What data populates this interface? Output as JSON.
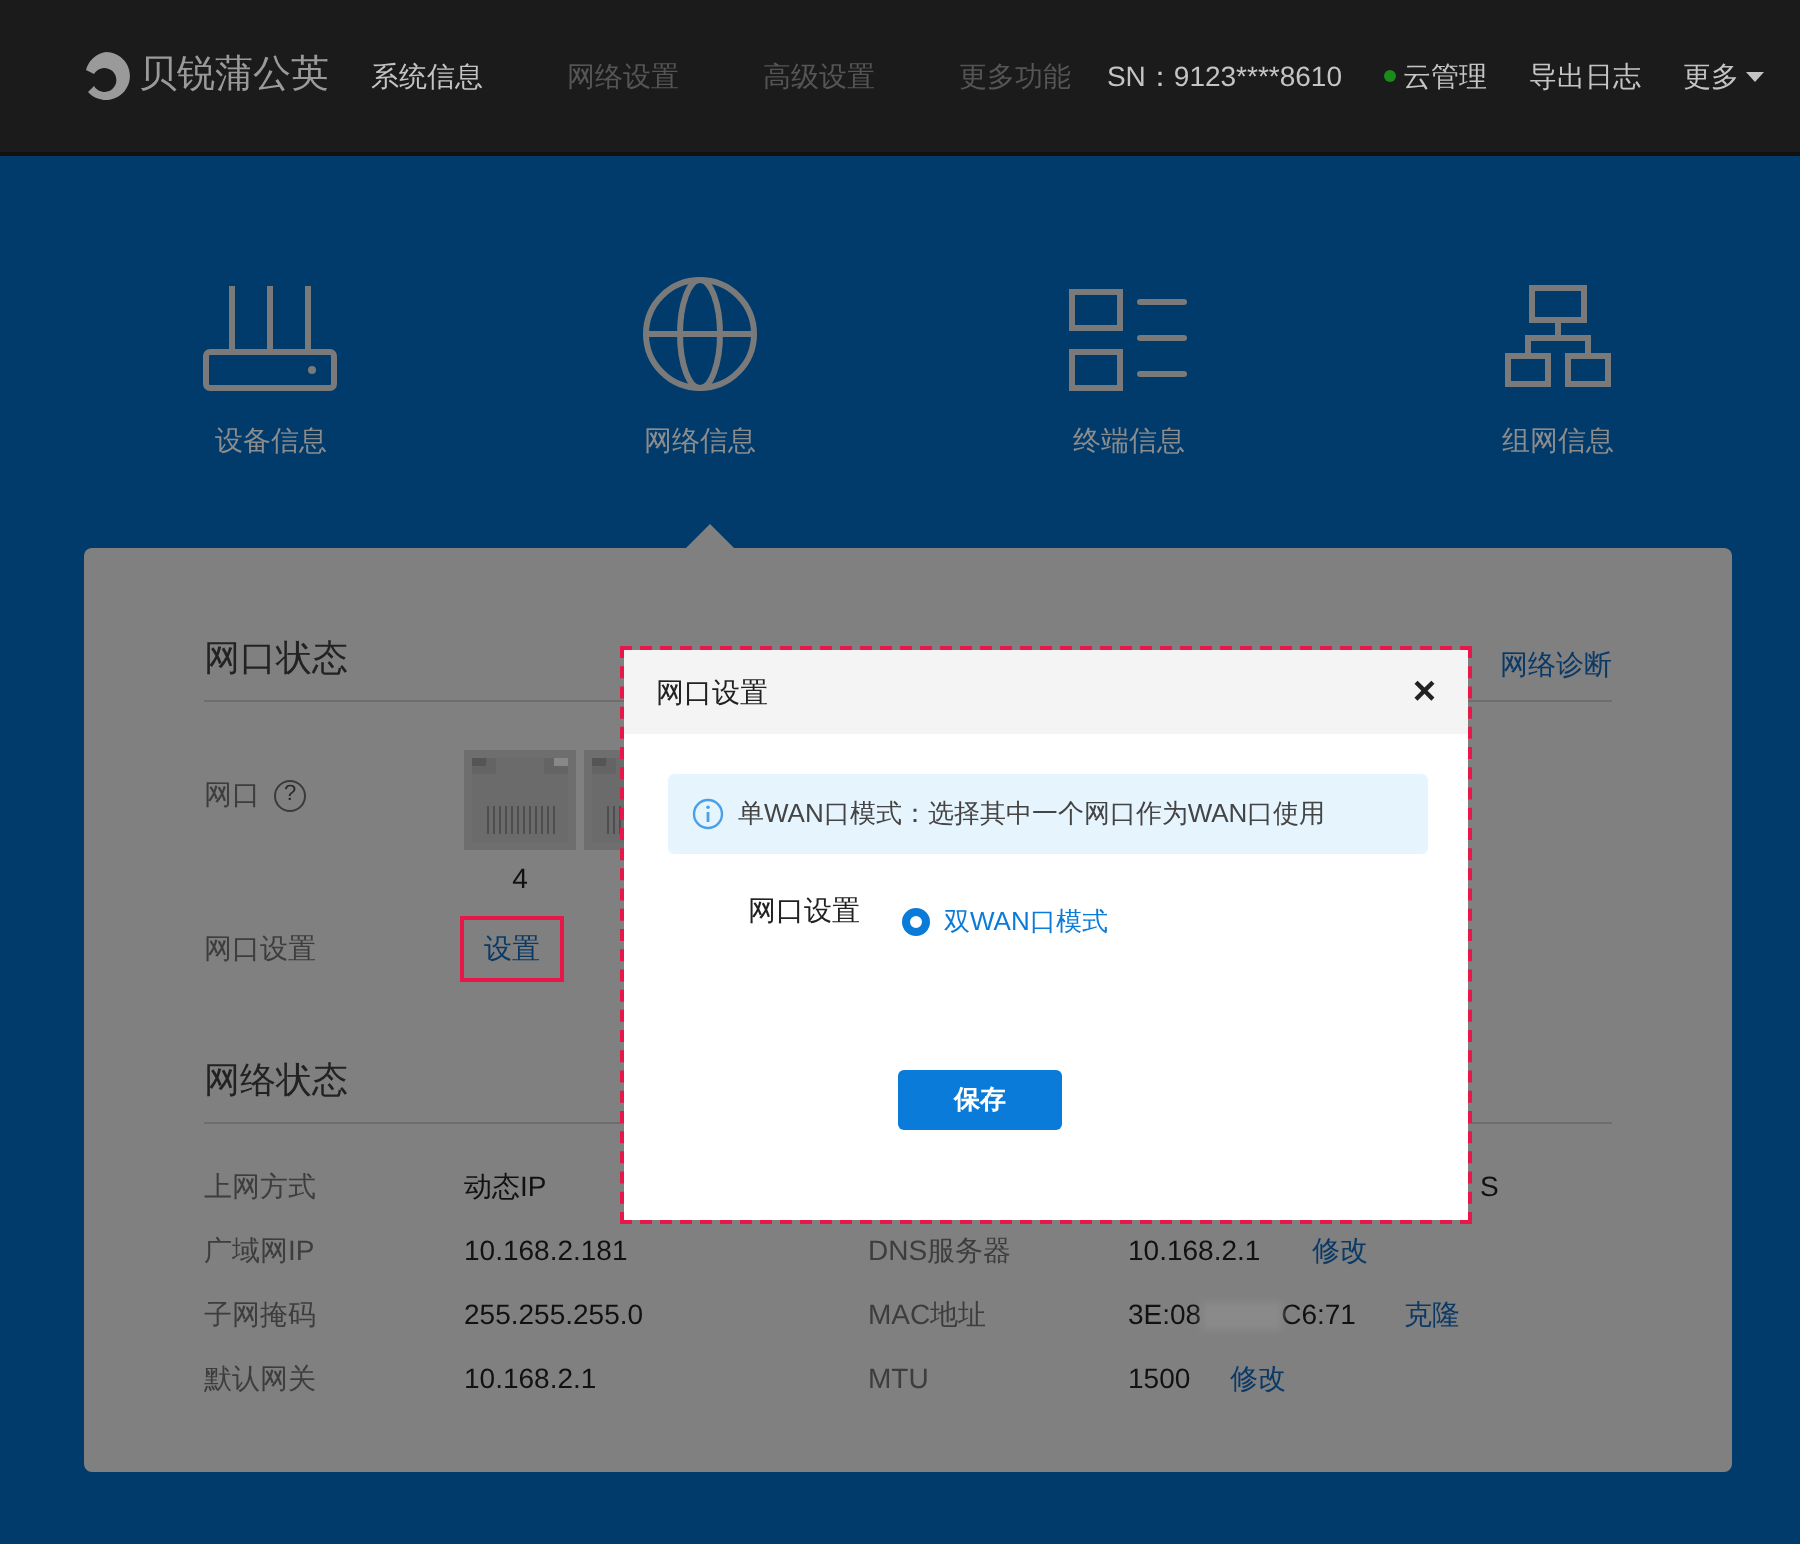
{
  "navbar": {
    "logo": "贝锐蒲公英",
    "items": [
      {
        "label": "系统信息",
        "selected": true
      },
      {
        "label": "网络设置",
        "selected": false
      },
      {
        "label": "高级设置",
        "selected": false
      },
      {
        "label": "更多功能",
        "selected": false
      }
    ],
    "sn": "SN：9123****8610",
    "cloud": {
      "label": "云管理",
      "online": true
    },
    "export": "导出日志",
    "more": "更多"
  },
  "categories": [
    {
      "label": "设备信息",
      "kind": "router",
      "selected": false
    },
    {
      "label": "网络信息",
      "kind": "globe",
      "selected": true
    },
    {
      "label": "终端信息",
      "kind": "list",
      "selected": false
    },
    {
      "label": "组网信息",
      "kind": "network",
      "selected": false
    }
  ],
  "port_status": {
    "title": "网口状态",
    "diagnose_link": "网络诊断",
    "port_label": "网口",
    "help": "?",
    "ports": [
      {
        "kind": "lan",
        "label": "4"
      },
      {
        "kind": "lan"
      }
    ],
    "setting_label": "网口设置",
    "setting_link": {
      "label": "设置",
      "highlighted": true
    }
  },
  "network_status": {
    "title": "网络状态",
    "rows": [
      {
        "label": "上网方式",
        "value": "动态IP",
        "right": {
          "value": "S"
        }
      },
      {
        "label": "广域网IP",
        "value": "10.168.2.181",
        "right": {
          "label": "DNS服务器",
          "value": "10.168.2.1",
          "link": "修改"
        }
      },
      {
        "label": "子网掩码",
        "value": "255.255.255.0",
        "right": {
          "label": "MAC地址",
          "value": "3E:08",
          "masked": true,
          "value_end": "C6:71",
          "link": "克隆"
        }
      },
      {
        "label": "默认网关",
        "value": "10.168.2.1",
        "right": {
          "label": "MTU",
          "value": "1500",
          "link": "修改"
        }
      }
    ]
  },
  "modal": {
    "title": "网口设置",
    "close": "×",
    "highlighted": true,
    "info": "单WAN口模式：选择其中一个网口作为WAN口使用",
    "field_label": "网口设置",
    "options": [
      {
        "label": "双WAN口模式",
        "selected": true
      }
    ],
    "save": "保存"
  }
}
